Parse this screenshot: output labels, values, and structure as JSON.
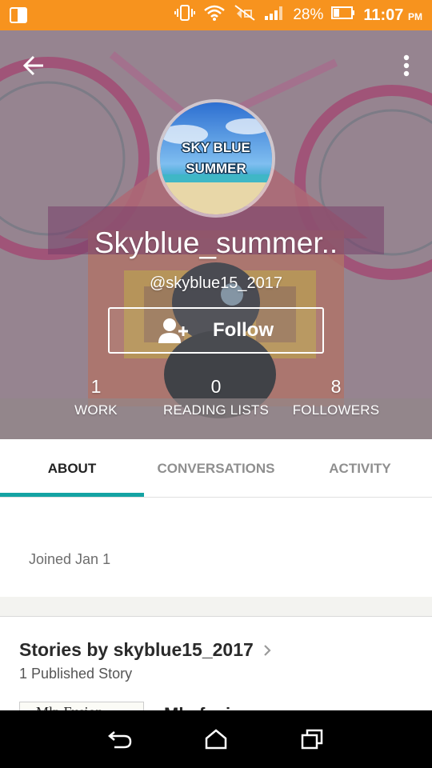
{
  "status_bar": {
    "battery_percent": "28%",
    "time": "11:07",
    "ampm": "PM"
  },
  "profile": {
    "display_name": "Skyblue_summer..",
    "username": "@skyblue15_2017",
    "avatar_text_line1": "SKY BLUE",
    "avatar_text_line2": "SUMMER",
    "follow_label": "Follow"
  },
  "stats": [
    {
      "value": "1",
      "label": "WORK"
    },
    {
      "value": "0",
      "label": "READING LISTS"
    },
    {
      "value": "8",
      "label": "FOLLOWERS"
    }
  ],
  "tabs": [
    {
      "label": "ABOUT",
      "active": true
    },
    {
      "label": "CONVERSATIONS",
      "active": false
    },
    {
      "label": "ACTIVITY",
      "active": false
    }
  ],
  "about": {
    "joined": "Joined Jan 1"
  },
  "stories": {
    "title": "Stories by skyblue15_2017",
    "subtitle": "1 Published Story",
    "first_cover_text": "Mlp Fusion",
    "first_title": "Mlp fusion"
  },
  "colors": {
    "status_bar": "#f7931e",
    "tab_indicator": "#14a3a3",
    "nav_bar": "#000000"
  },
  "icons": {
    "back": "arrow-left-icon",
    "more": "more-vert-icon",
    "follow": "add-person-icon",
    "chevron": "chevron-right-icon",
    "nav_back": "nav-back-icon",
    "nav_home": "nav-home-icon",
    "nav_recents": "nav-recents-icon"
  }
}
